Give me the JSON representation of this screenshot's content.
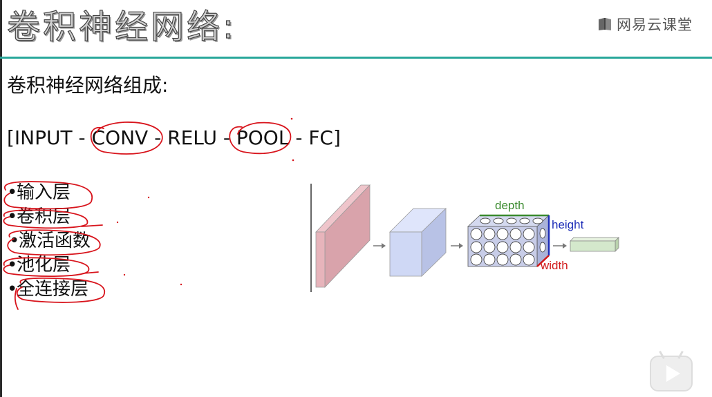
{
  "slide": {
    "title": "卷积神经网络:",
    "subtitle": "卷积神经网络组成:",
    "formula": "[INPUT - CONV - RELU - POOL - FC]",
    "bullets": [
      {
        "bullet": "•",
        "label": "输入层"
      },
      {
        "bullet": "•",
        "label": "卷积层"
      },
      {
        "bullet": "•",
        "label": "激活函数"
      },
      {
        "bullet": "•",
        "label": "池化层"
      },
      {
        "bullet": "•",
        "label": "全连接层"
      }
    ]
  },
  "brand": {
    "name": "网易云课堂",
    "icon": "book-icon"
  },
  "diagram": {
    "labels": {
      "depth": "depth",
      "height": "height",
      "width": "width"
    },
    "colors": {
      "input_layer": "#d9a3ab",
      "conv_block": "#cfd8f5",
      "feature_volume": "#c8cde8",
      "output": "#d4e8cc",
      "depth": "#3a8a2e",
      "height": "#1f2fb8",
      "width": "#d11a1a",
      "annotation": "#d8141c",
      "accent_rule": "#28a79a"
    }
  },
  "player": {
    "play_icon": "play-icon"
  }
}
